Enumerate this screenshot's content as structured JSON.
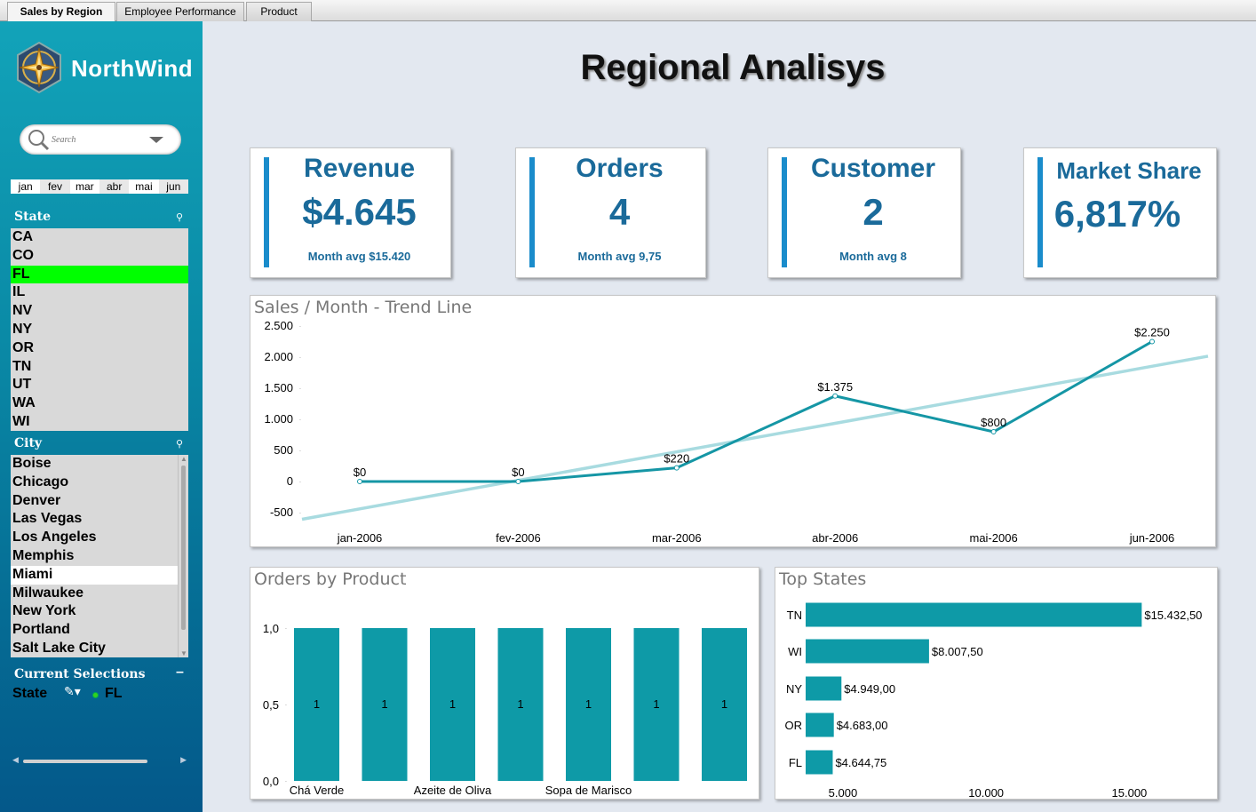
{
  "tabs": [
    {
      "label": "Sales by Region",
      "active": true
    },
    {
      "label": "Employee Performance",
      "active": false
    },
    {
      "label": "Product",
      "active": false
    }
  ],
  "sidebar": {
    "brand": "NorthWind",
    "search_placeholder": "Search",
    "months": [
      "jan",
      "fev",
      "mar",
      "abr",
      "mai",
      "jun"
    ],
    "state_title": "State",
    "states": [
      {
        "label": "CA",
        "selected": false
      },
      {
        "label": "CO",
        "selected": false
      },
      {
        "label": "FL",
        "selected": true
      },
      {
        "label": "IL",
        "selected": false
      },
      {
        "label": "NV",
        "selected": false
      },
      {
        "label": "NY",
        "selected": false
      },
      {
        "label": "OR",
        "selected": false
      },
      {
        "label": "TN",
        "selected": false
      },
      {
        "label": "UT",
        "selected": false
      },
      {
        "label": "WA",
        "selected": false
      },
      {
        "label": "WI",
        "selected": false
      }
    ],
    "city_title": "City",
    "cities": [
      {
        "label": "Boise",
        "possible": false
      },
      {
        "label": "Chicago",
        "possible": false
      },
      {
        "label": "Denver",
        "possible": false
      },
      {
        "label": "Las Vegas",
        "possible": false
      },
      {
        "label": "Los Angeles",
        "possible": false
      },
      {
        "label": "Memphis",
        "possible": false
      },
      {
        "label": "Miami",
        "possible": true
      },
      {
        "label": "Milwaukee",
        "possible": false
      },
      {
        "label": "New York",
        "possible": false
      },
      {
        "label": "Portland",
        "possible": false
      },
      {
        "label": "Salt Lake City",
        "possible": false
      }
    ],
    "current_selections": {
      "title": "Current Selections",
      "field": "State",
      "value": "FL"
    },
    "colors": {
      "selected": "#00ff00",
      "possible": "#ffffff",
      "excluded": "#d9d9d9"
    }
  },
  "header": {
    "title": "Regional Analisys"
  },
  "kpis": [
    {
      "label": "Revenue",
      "value": "$4.645",
      "sub": "Month avg $15.420"
    },
    {
      "label": "Orders",
      "value": "4",
      "sub": "Month avg 9,75"
    },
    {
      "label": "Customer",
      "value": "2",
      "sub": "Month avg 8"
    },
    {
      "label": "Market Share",
      "value": "6,817%",
      "sub": ""
    }
  ],
  "chart_data": [
    {
      "type": "line",
      "title": "Sales / Month - Trend Line",
      "categories": [
        "jan-2006",
        "fev-2006",
        "mar-2006",
        "abr-2006",
        "mai-2006",
        "jun-2006"
      ],
      "series": [
        {
          "values": [
            0,
            0,
            220,
            1375,
            800,
            2250
          ],
          "labels": [
            "$0",
            "$0",
            "$220",
            "$1.375",
            "$800",
            "$2.250"
          ],
          "color": "#1596a5"
        },
        {
          "values": [
            -440,
            123,
            557,
            989,
            1421,
            1853
          ],
          "trend": true,
          "color": "#a8dbe0"
        }
      ],
      "yticks": [
        "2.500",
        "2.000",
        "1.500",
        "1.000",
        "500",
        "0",
        "-500"
      ],
      "ylim": [
        -500,
        2500
      ]
    },
    {
      "type": "bar",
      "title": "Orders by Product",
      "categories": [
        "Chá Verde",
        "",
        "Azeite de Oliva",
        "",
        "Sopa de Marisco",
        "",
        ""
      ],
      "values": [
        1,
        1,
        1,
        1,
        1,
        1,
        1
      ],
      "yticks": [
        "1,0",
        "0,5",
        "0,0"
      ],
      "ylim": [
        0,
        1
      ],
      "color": "#0e9aa7"
    },
    {
      "type": "bar",
      "orientation": "horizontal",
      "title": "Top States",
      "categories": [
        "TN",
        "WI",
        "NY",
        "OR",
        "FL"
      ],
      "values": [
        15432.5,
        8007.5,
        4949,
        4683,
        4644.75
      ],
      "labels": [
        "$15.432,50",
        "$8.007,50",
        "$4.949,00",
        "$4.683,00",
        "$4.644,75"
      ],
      "xticks": [
        "5.000",
        "10.000",
        "15.000"
      ],
      "xlim": [
        3700,
        16600
      ],
      "color": "#0e9aa7"
    }
  ]
}
